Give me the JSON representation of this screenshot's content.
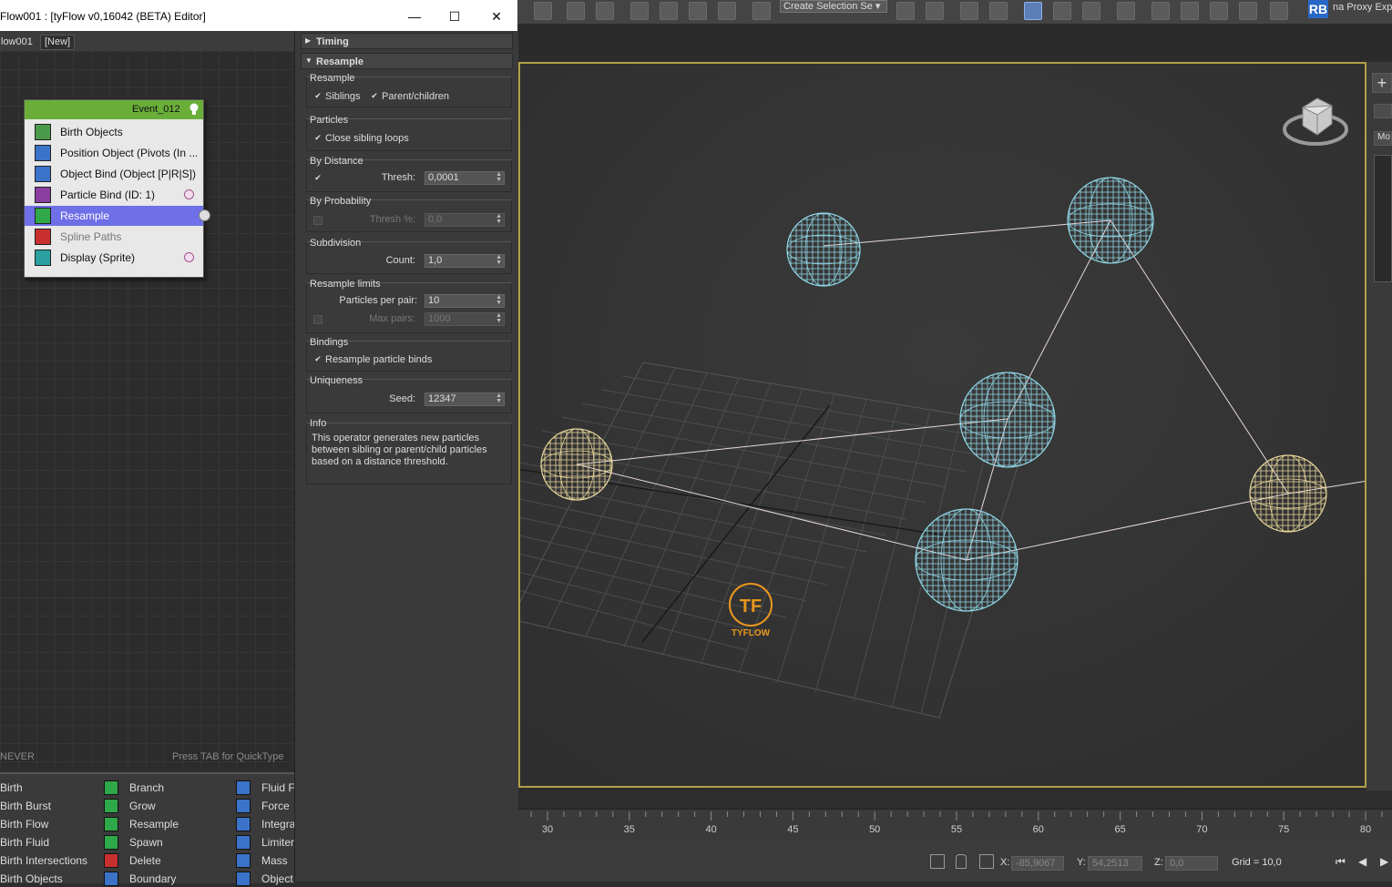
{
  "editor": {
    "title": "Flow001 : [tyFlow v0,16042 (BETA) Editor]",
    "minimize": "—",
    "maximize": "☐",
    "close": "✕",
    "tabs": [
      "low001",
      "[New]"
    ],
    "graph_left_hint": "NEVER",
    "graph_right_hint": "Press TAB for QuickType"
  },
  "event": {
    "name": "Event_012",
    "operators": [
      {
        "label": "Birth Objects",
        "icon_color": "#4a9a4a",
        "state": "normal",
        "dot": false
      },
      {
        "label": "Position Object (Pivots (In ...",
        "icon_color": "#3b73c9",
        "state": "normal",
        "dot": false
      },
      {
        "label": "Object Bind (Object [P|R|S])",
        "icon_color": "#3b73c9",
        "state": "normal",
        "dot": false
      },
      {
        "label": "Particle Bind (ID: 1)",
        "icon_color": "#8a3fa0",
        "state": "normal",
        "dot": true
      },
      {
        "label": "Resample",
        "icon_color": "#2fa84a",
        "state": "selected",
        "dot": false
      },
      {
        "label": "Spline Paths",
        "icon_color": "#c83030",
        "state": "disabled",
        "dot": false
      },
      {
        "label": "Display (Sprite)",
        "icon_color": "#2aa0a0",
        "state": "normal",
        "dot": true
      }
    ]
  },
  "palette": {
    "col1": [
      "Birth",
      "Birth Burst",
      "Birth Flow",
      "Birth Fluid",
      "Birth Intersections",
      "Birth Objects"
    ],
    "col2": [
      "Branch",
      "Grow",
      "Resample",
      "Spawn",
      "Delete",
      "Boundary"
    ],
    "col3": [
      "Fluid Fc",
      "Force",
      "Integra",
      "Limiter",
      "Mass",
      "Object"
    ],
    "col1_color": "#2fa84a",
    "col2_colors": [
      "#2fa84a",
      "#2fa84a",
      "#2fa84a",
      "#2fa84a",
      "#c83030",
      "#3b73c9"
    ],
    "col3_color": "#3b73c9"
  },
  "props": {
    "rollouts": {
      "timing": "Timing",
      "resample": "Resample"
    },
    "groups": {
      "resample": "Resample",
      "particles": "Particles",
      "by_distance": "By Distance",
      "by_probability": "By Probability",
      "subdivision": "Subdivision",
      "limits": "Resample limits",
      "bindings": "Bindings",
      "uniqueness": "Uniqueness",
      "info": "Info"
    },
    "siblings": "Siblings",
    "parent_children": "Parent/children",
    "close_sibling_loops": "Close sibling loops",
    "thresh_label": "Thresh:",
    "thresh_value": "0,0001",
    "thresh_pct_label": "Thresh %:",
    "thresh_pct_value": "0,0",
    "count_label": "Count:",
    "count_value": "1,0",
    "particles_per_pair_label": "Particles per pair:",
    "particles_per_pair_value": "10",
    "max_pairs_label": "Max pairs:",
    "max_pairs_value": "1000",
    "resample_particle_binds": "Resample particle binds",
    "seed_label": "Seed:",
    "seed_value": "12347",
    "info_text": "This operator generates new particles between sibling or parent/child particles based on a distance threshold."
  },
  "toolbar": {
    "selection_set": "Create Selection Se",
    "rb_badge": "RB",
    "proxy_label": "na Proxy Exp"
  },
  "viewport": {
    "logo_text": "TYFLOW",
    "logo_glyph": "TF",
    "panel_label": "Mo"
  },
  "timeline": {
    "labels": [
      "30",
      "35",
      "40",
      "45",
      "50",
      "55",
      "60",
      "65",
      "70",
      "75",
      "80"
    ]
  },
  "status": {
    "x_label": "X:",
    "x_value": "-85,9067",
    "y_label": "Y:",
    "y_value": "54,2513",
    "z_label": "Z:",
    "z_value": "0,0",
    "grid": "Grid = 10,0"
  },
  "colors": {
    "selected_row": "#6f6fe8",
    "event_header": "#6aae3a",
    "sphere_blue": "#8fd6e6",
    "sphere_yellow": "#e6d49a",
    "viewport_border": "#b2a148",
    "logo_orange": "#e8961e"
  }
}
